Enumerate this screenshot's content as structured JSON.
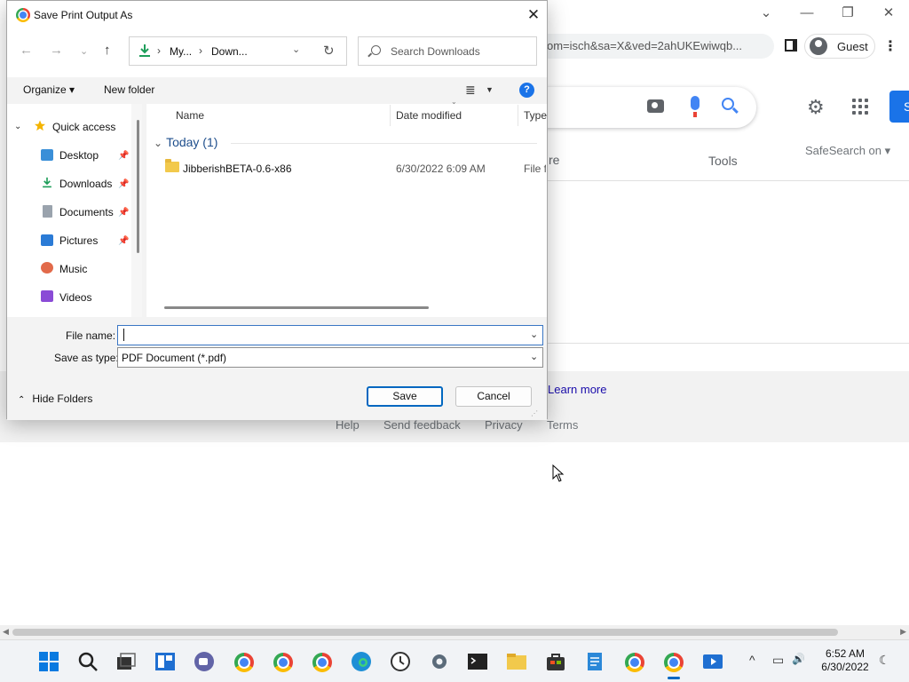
{
  "dialog": {
    "title": "Save Print Output As",
    "close": "✕",
    "nav": {
      "back": "←",
      "forward": "→",
      "recent": "⌄",
      "up": "↑"
    },
    "address": {
      "crumbs": [
        "My...",
        "Down..."
      ],
      "separator": "›",
      "dropdown": "⌄",
      "refresh": "↻"
    },
    "search": {
      "placeholder": "Search Downloads",
      "value": ""
    },
    "commands": {
      "organize": "Organize ▾",
      "new_folder": "New folder",
      "view_icon": "≣",
      "view_dd": "▼",
      "help": "?"
    },
    "navpane": {
      "expander": "⌄",
      "items": [
        {
          "label": "Quick access",
          "icon": "star-icon",
          "pinned": false
        },
        {
          "label": "Desktop",
          "icon": "desktop-icon",
          "pinned": true
        },
        {
          "label": "Downloads",
          "icon": "download-icon",
          "pinned": true
        },
        {
          "label": "Documents",
          "icon": "document-icon",
          "pinned": true
        },
        {
          "label": "Pictures",
          "icon": "picture-icon",
          "pinned": true
        },
        {
          "label": "Music",
          "icon": "music-icon",
          "pinned": false
        },
        {
          "label": "Videos",
          "icon": "video-icon",
          "pinned": false
        }
      ],
      "pin_glyph": "📌"
    },
    "columns": [
      "Name",
      "Date modified",
      "Type"
    ],
    "group": {
      "chevron": "⌄",
      "label": "Today (1)"
    },
    "files": [
      {
        "name": "JibberishBETA-0.6-x86",
        "date": "6/30/2022 6:09 AM",
        "type": "File fo"
      }
    ],
    "file_name_label": "File name:",
    "file_name_value": "",
    "save_type_label": "Save as type:",
    "save_type_value": "PDF Document (*.pdf)",
    "combo_caret": "⌄",
    "hide_folders": "Hide Folders",
    "hide_chev": "⌃",
    "save_button": "Save",
    "cancel_button": "Cancel",
    "grip": "⋰"
  },
  "browser": {
    "url_fragment": "om=isch&sa=X&ved=2ahUKEwiwqb...",
    "profile": "Guest",
    "kebab": "⋮",
    "window": {
      "minimize": "—",
      "restore": "❐",
      "close": "✕",
      "tabs_dd": "⌄"
    },
    "signin_partial": "S",
    "tab_partial": "re",
    "tools": "Tools",
    "safesearch": "SafeSearch on ▾",
    "gear": "⚙",
    "learn_more": "Learn more",
    "footer": [
      "Help",
      "Send feedback",
      "Privacy",
      "Terms"
    ],
    "scroll_left": "◀",
    "scroll_right": "▶"
  },
  "taskbar": {
    "time": "6:52 AM",
    "date": "6/30/2022",
    "tray_chevron": "^",
    "network": "▭",
    "volume": "🔊",
    "notifications": "☾"
  },
  "colors": {
    "accent": "#0067c0",
    "google_blue": "#4285f4",
    "link": "#1a0dab"
  }
}
